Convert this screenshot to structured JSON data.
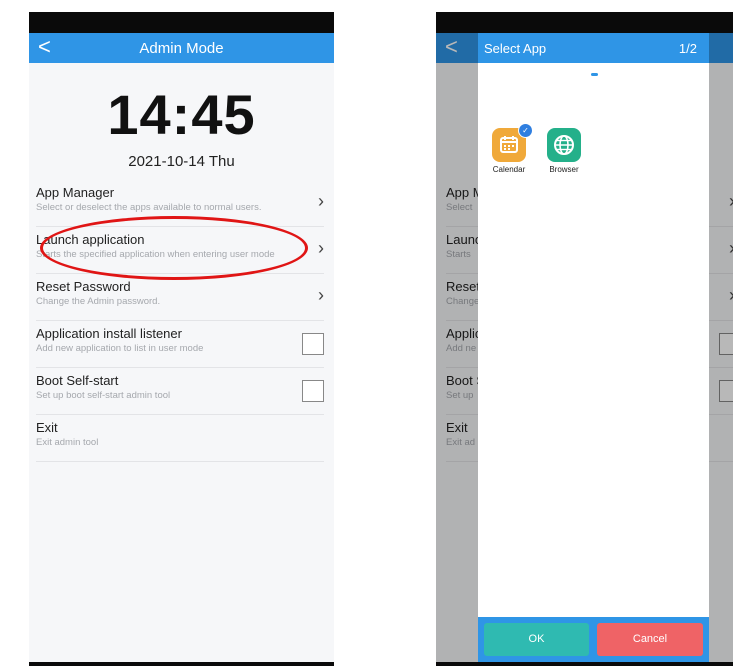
{
  "left_screen": {
    "header": {
      "back_glyph": "<",
      "title": "Admin Mode"
    },
    "clock": "14:45",
    "date": "2021-10-14 Thu",
    "menu": [
      {
        "title": "App Manager",
        "subtitle": "Select or deselect the apps available to normal users.",
        "control": "chevron"
      },
      {
        "title": "Launch application",
        "subtitle": "Starts the specified application when entering user mode",
        "control": "chevron"
      },
      {
        "title": "Reset Password",
        "subtitle": "Change the Admin password.",
        "control": "chevron"
      },
      {
        "title": "Application install listener",
        "subtitle": "Add new application to list in user mode",
        "control": "checkbox",
        "checked": false
      },
      {
        "title": "Boot Self-start",
        "subtitle": "Set up boot self-start admin tool",
        "control": "checkbox",
        "checked": false
      },
      {
        "title": "Exit",
        "subtitle": "Exit admin tool",
        "control": "none"
      }
    ],
    "annotation_color": "#e01515"
  },
  "right_screen": {
    "background_menu": [
      {
        "title": "App M",
        "subtitle": "Select"
      },
      {
        "title": "Launc",
        "subtitle": "Starts"
      },
      {
        "title": "Reset",
        "subtitle": "Change"
      },
      {
        "title": "Applic",
        "subtitle": "Add ne"
      },
      {
        "title": "Boot S",
        "subtitle": "Set up"
      },
      {
        "title": "Exit",
        "subtitle": "Exit ad"
      }
    ],
    "dialog": {
      "title": "Select App",
      "page_indicator": "1/2",
      "apps": [
        {
          "label": "Calendar",
          "icon": "calendar-icon",
          "color": "#f0a93a",
          "selected": true
        },
        {
          "label": "Browser",
          "icon": "globe-icon",
          "color": "#24b08a",
          "selected": false
        }
      ],
      "ok_label": "OK",
      "cancel_label": "Cancel"
    }
  },
  "colors": {
    "accent": "#2f95e6",
    "ok": "#2fbab1",
    "cancel": "#ef6366"
  }
}
